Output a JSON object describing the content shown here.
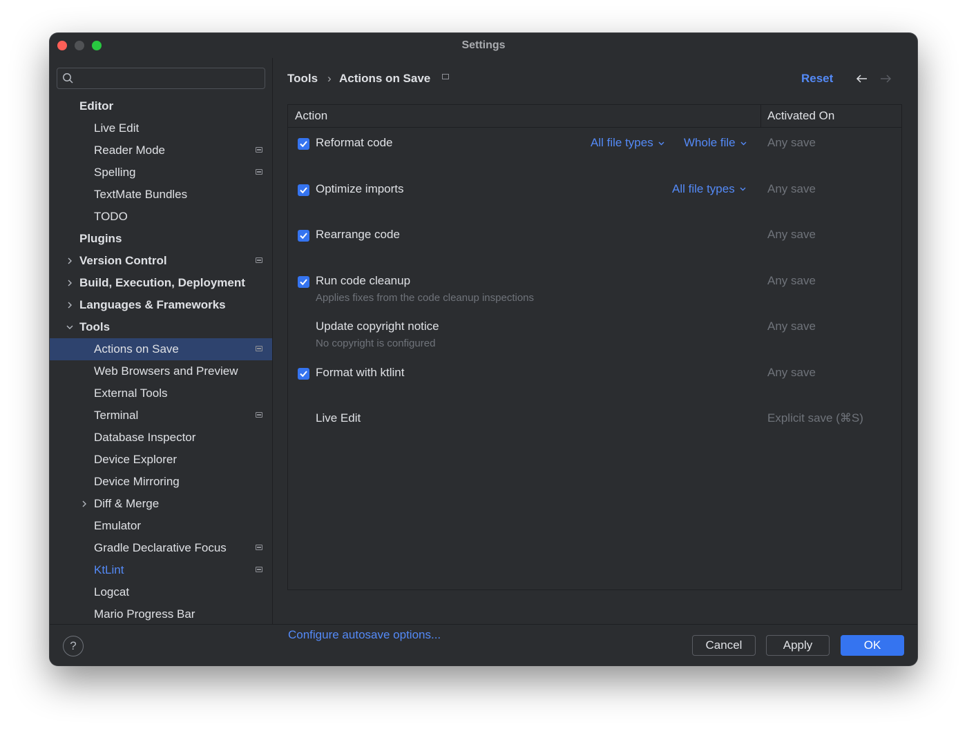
{
  "window": {
    "title": "Settings"
  },
  "sidebar": {
    "search_placeholder": "",
    "items": [
      {
        "label": "Editor",
        "bold": true
      },
      {
        "label": "Live Edit"
      },
      {
        "label": "Reader Mode",
        "project_icon": true
      },
      {
        "label": "Spelling",
        "project_icon": true
      },
      {
        "label": "TextMate Bundles"
      },
      {
        "label": "TODO"
      },
      {
        "label": "Plugins",
        "bold": true
      },
      {
        "label": "Version Control",
        "bold": true,
        "expandable": true,
        "project_icon": true
      },
      {
        "label": "Build, Execution, Deployment",
        "bold": true,
        "expandable": true
      },
      {
        "label": "Languages & Frameworks",
        "bold": true,
        "expandable": true
      },
      {
        "label": "Tools",
        "bold": true,
        "expanded": true
      },
      {
        "label": "Actions on Save",
        "selected": true,
        "project_icon": true
      },
      {
        "label": "Web Browsers and Preview"
      },
      {
        "label": "External Tools"
      },
      {
        "label": "Terminal",
        "project_icon": true
      },
      {
        "label": "Database Inspector"
      },
      {
        "label": "Device Explorer"
      },
      {
        "label": "Device Mirroring"
      },
      {
        "label": "Diff & Merge",
        "expandable": true
      },
      {
        "label": "Emulator"
      },
      {
        "label": "Gradle Declarative Focus",
        "project_icon": true
      },
      {
        "label": "KtLint",
        "link": true,
        "project_icon": true
      },
      {
        "label": "Logcat"
      },
      {
        "label": "Mario Progress Bar"
      }
    ]
  },
  "main": {
    "breadcrumb": {
      "parent": "Tools",
      "separator": "›",
      "current": "Actions on Save"
    },
    "reset_label": "Reset",
    "table": {
      "col_action": "Action",
      "col_activated": "Activated On",
      "rows": [
        {
          "label": "Reformat code",
          "checked": true,
          "dropdowns": [
            "All file types",
            "Whole file"
          ],
          "activated": "Any save"
        },
        {
          "label": "Optimize imports",
          "checked": true,
          "dropdowns": [
            "All file types"
          ],
          "activated": "Any save"
        },
        {
          "label": "Rearrange code",
          "checked": true,
          "activated": "Any save"
        },
        {
          "label": "Run code cleanup",
          "checked": true,
          "description": "Applies fixes from the code cleanup inspections",
          "activated": "Any save"
        },
        {
          "label": "Update copyright notice",
          "checked": false,
          "description": "No copyright is configured",
          "activated": "Any save"
        },
        {
          "label": "Format with ktlint",
          "checked": true,
          "activated": "Any save"
        },
        {
          "label": "Live Edit",
          "checked": false,
          "activated": "Explicit save (⌘S)"
        }
      ]
    },
    "config_link": "Configure autosave options..."
  },
  "footer": {
    "help_label": "?",
    "cancel_label": "Cancel",
    "apply_label": "Apply",
    "ok_label": "OK"
  },
  "colors": {
    "accent": "#3574f0",
    "link": "#548af7",
    "background": "#2b2d30",
    "selection": "#2e436e"
  }
}
